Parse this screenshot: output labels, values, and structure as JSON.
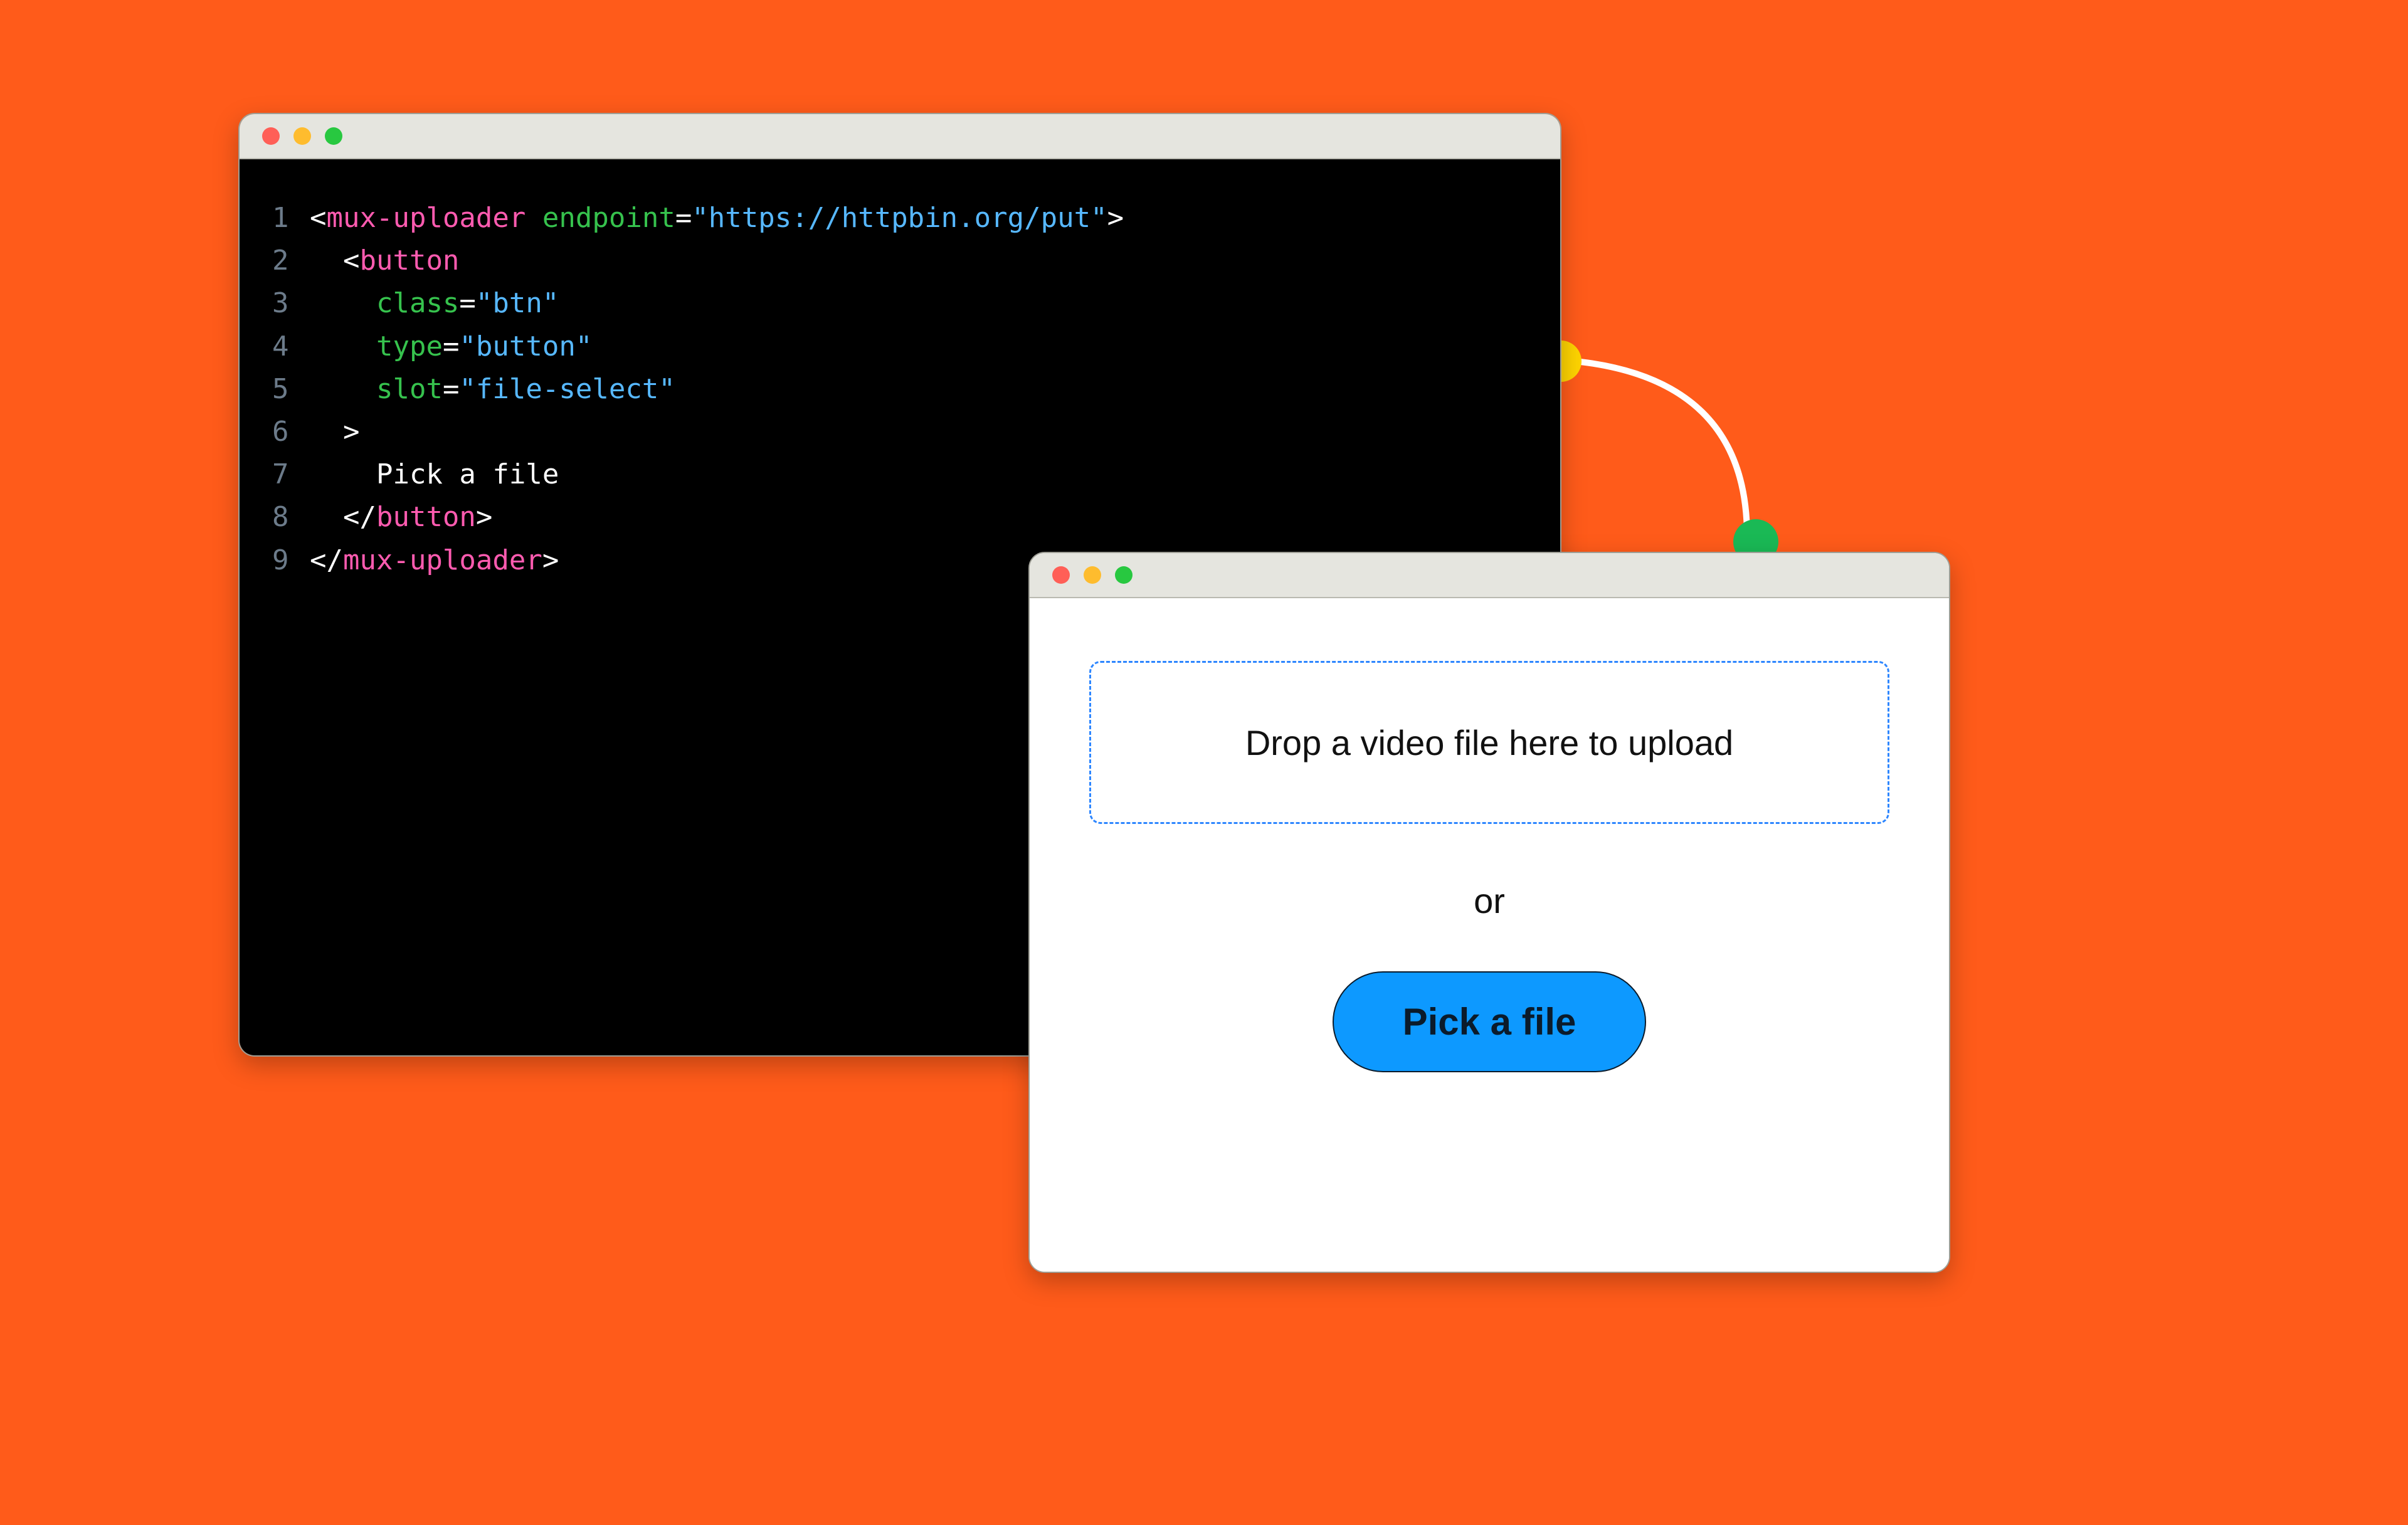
{
  "code": {
    "lines": [
      {
        "n": "1",
        "tokens": [
          [
            "punc",
            "<"
          ],
          [
            "tag",
            "mux-uploader"
          ],
          [
            "punc",
            " "
          ],
          [
            "attr",
            "endpoint"
          ],
          [
            "punc",
            "="
          ],
          [
            "str",
            "\"https://httpbin.org/put\""
          ],
          [
            "punc",
            ">"
          ]
        ]
      },
      {
        "n": "2",
        "tokens": [
          [
            "punc",
            "  <"
          ],
          [
            "tag",
            "button"
          ]
        ]
      },
      {
        "n": "3",
        "tokens": [
          [
            "punc",
            "    "
          ],
          [
            "attr",
            "class"
          ],
          [
            "punc",
            "="
          ],
          [
            "str",
            "\"btn\""
          ]
        ]
      },
      {
        "n": "4",
        "tokens": [
          [
            "punc",
            "    "
          ],
          [
            "attr",
            "type"
          ],
          [
            "punc",
            "="
          ],
          [
            "str",
            "\"button\""
          ]
        ]
      },
      {
        "n": "5",
        "tokens": [
          [
            "punc",
            "    "
          ],
          [
            "attr",
            "slot"
          ],
          [
            "punc",
            "="
          ],
          [
            "str",
            "\"file-select\""
          ]
        ]
      },
      {
        "n": "6",
        "tokens": [
          [
            "punc",
            "  >"
          ]
        ]
      },
      {
        "n": "7",
        "tokens": [
          [
            "text",
            "    Pick a file"
          ]
        ]
      },
      {
        "n": "8",
        "tokens": [
          [
            "punc",
            "  </"
          ],
          [
            "tag",
            "button"
          ],
          [
            "punc",
            ">"
          ]
        ]
      },
      {
        "n": "9",
        "tokens": [
          [
            "punc",
            "</"
          ],
          [
            "tag",
            "mux-uploader"
          ],
          [
            "punc",
            ">"
          ]
        ]
      }
    ]
  },
  "upload": {
    "drop_label": "Drop a video file here to upload",
    "or_label": "or",
    "button_label": "Pick a file"
  },
  "colors": {
    "background": "#ff5b1a",
    "accent_blue": "#0d99ff",
    "tag_pink": "#ff5bb0",
    "attr_green": "#36c24d",
    "string_blue": "#57b8ff"
  }
}
